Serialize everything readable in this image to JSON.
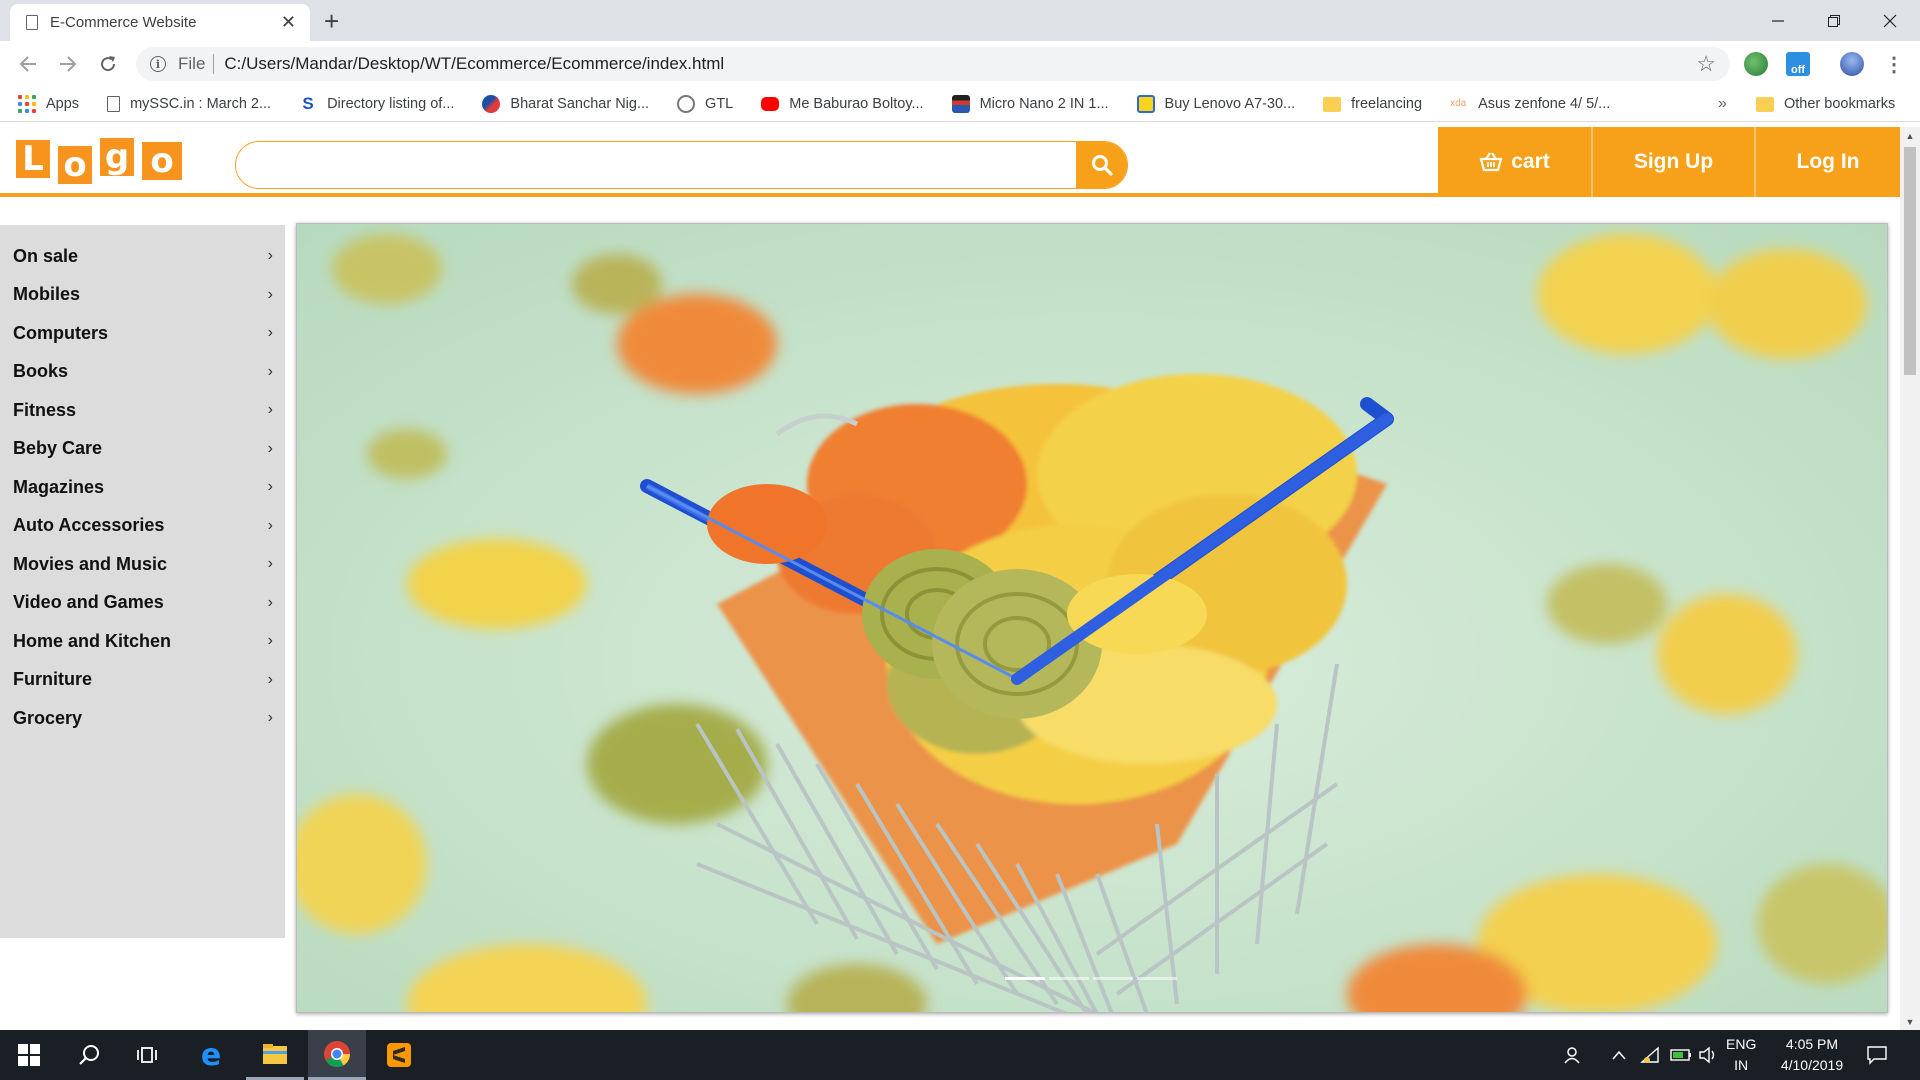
{
  "browser": {
    "tab_title": "E-Commerce Website",
    "url_scheme": "File",
    "url": "C:/Users/Mandar/Desktop/WT/Ecommerce/Ecommerce/index.html",
    "bookmarks": [
      {
        "label": "Apps",
        "icon": "apps-grid-icon"
      },
      {
        "label": "mySSC.in : March 2...",
        "icon": "page-icon"
      },
      {
        "label": "Directory listing of...",
        "icon": "s-favicon"
      },
      {
        "label": "Bharat Sanchar Nig...",
        "icon": "bsnl-favicon"
      },
      {
        "label": "GTL",
        "icon": "gtl-favicon"
      },
      {
        "label": "Me Baburao Boltoy...",
        "icon": "youtube-favicon"
      },
      {
        "label": "Micro Nano 2 IN 1...",
        "icon": "shop-favicon"
      },
      {
        "label": "Buy Lenovo A7-30...",
        "icon": "flipkart-favicon"
      },
      {
        "label": "freelancing",
        "icon": "folder-icon"
      },
      {
        "label": "Asus zenfone 4/ 5/...",
        "icon": "xda-favicon"
      }
    ],
    "bookmarks_overflow": "»",
    "other_bookmarks": "Other bookmarks",
    "extension_badge": "off"
  },
  "site": {
    "logo_letters": [
      "L",
      "o",
      "g",
      "o"
    ],
    "search_placeholder": "",
    "nav": {
      "cart": "cart",
      "signup": "Sign Up",
      "login": "Log In"
    },
    "categories": [
      "On sale",
      "Mobiles",
      "Computers",
      "Books",
      "Fitness",
      "Beby Care",
      "Magazines",
      "Auto Accessories",
      "Movies and Music",
      "Video and Games",
      "Home and Kitchen",
      "Furniture",
      "Grocery"
    ],
    "carousel_slides": 4,
    "carousel_active": 0
  },
  "taskbar": {
    "language": "ENG",
    "region": "IN",
    "time": "4:05 PM",
    "date": "4/10/2019"
  },
  "colors": {
    "accent": "#f7a11a",
    "logo": "#f7941d",
    "sidebar": "#dcdcdc",
    "taskbar": "#1a1f26"
  }
}
